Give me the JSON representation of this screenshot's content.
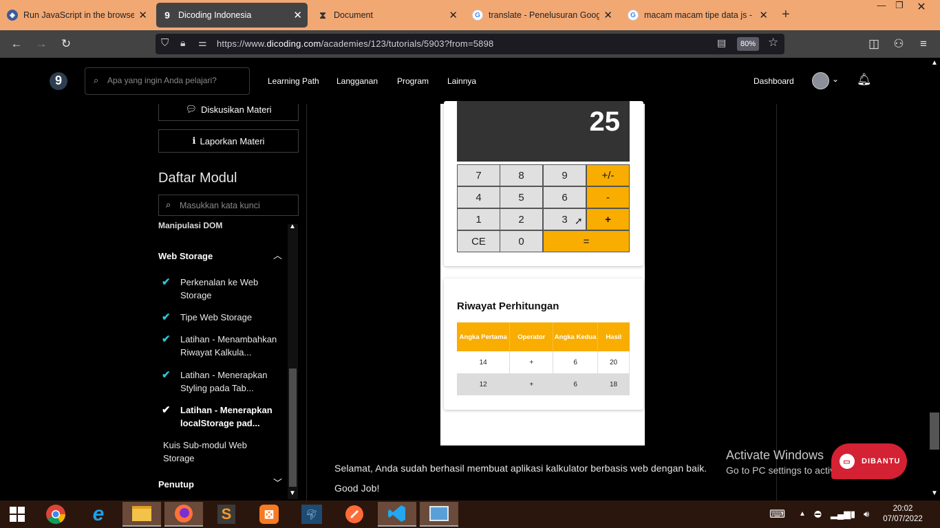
{
  "browser": {
    "tabs": [
      {
        "title": "Run JavaScript in the browser - ",
        "fav": "playcode-icon"
      },
      {
        "title": "Dicoding Indonesia",
        "fav": "dicoding-icon",
        "active": true
      },
      {
        "title": "Document",
        "fav": "hourglass-icon"
      },
      {
        "title": "translate - Penelusuran Google",
        "fav": "google-icon"
      },
      {
        "title": "macam macam tipe data js - Pe",
        "fav": "google-icon"
      }
    ],
    "new_tab": "+",
    "url_prefix": "https://www.",
    "url_domain": "dicoding.com",
    "url_path": "/academies/123/tutorials/5903?from=5898",
    "zoom": "80%"
  },
  "site": {
    "logo": "9",
    "search_placeholder": "Apa yang ingin Anda pelajari?",
    "nav": [
      "Learning Path",
      "Langganan",
      "Program",
      "Lainnya"
    ],
    "dashboard": "Dashboard"
  },
  "sidebar": {
    "discuss": "Diskusikan Materi",
    "report": "Laporkan Materi",
    "module_title": "Daftar Modul",
    "search_placeholder": "Masukkan kata kunci",
    "prev_section": "Manipulasi DOM",
    "section": "Web Storage",
    "items": [
      {
        "label": "Perkenalan ke Web Storage",
        "done": true
      },
      {
        "label": "Tipe Web Storage",
        "done": true
      },
      {
        "label": "Latihan - Menambahkan Riwayat Kalkula...",
        "done": true
      },
      {
        "label": "Latihan - Menerapkan Styling pada Tab...",
        "done": true
      },
      {
        "label": "Latihan - Menerapkan localStorage pad...",
        "done": true,
        "current": true
      },
      {
        "label": "Kuis Sub-modul Web Storage",
        "done": false
      }
    ],
    "next_section": "Penutup"
  },
  "calculator": {
    "display": "25",
    "keys": [
      [
        "7",
        "8",
        "9",
        "+/-"
      ],
      [
        "4",
        "5",
        "6",
        "-"
      ],
      [
        "1",
        "2",
        "3",
        "+"
      ],
      [
        "CE",
        "0",
        "="
      ]
    ]
  },
  "history": {
    "title": "Riwayat Perhitungan",
    "headers": [
      "Angka Pertama",
      "Operator",
      "Angka Kedua",
      "Hasil"
    ],
    "rows": [
      [
        "14",
        "+",
        "6",
        "20"
      ],
      [
        "12",
        "+",
        "6",
        "18"
      ]
    ]
  },
  "content": {
    "para1": "Selamat, Anda sudah berhasil membuat aplikasi kalkulator berbasis web dengan baik.",
    "para2": "Good Job!"
  },
  "overlay": {
    "activate_title": "Activate Windows",
    "activate_sub": "Go to PC settings to activate Windows.",
    "dibantu": "DIBANTU"
  },
  "taskbar": {
    "time": "20:02",
    "date": "07/07/2022"
  },
  "colors": {
    "accent": "#f8ad00",
    "tabstrip": "#f2a873",
    "check": "#2ec4d6",
    "chat": "#d42133"
  }
}
